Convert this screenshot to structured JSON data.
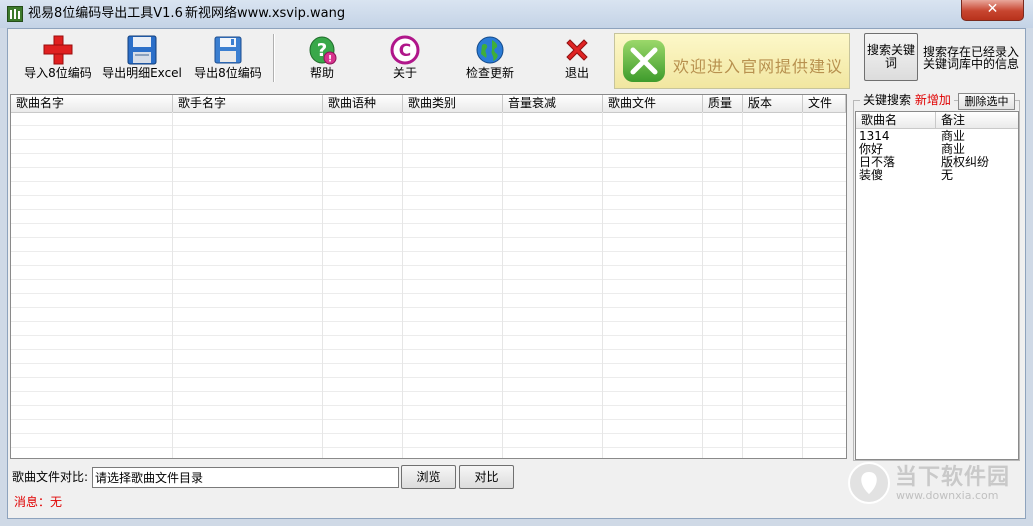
{
  "window": {
    "title": "视易8位编码导出工具V1.6",
    "subtitle": "新视网络www.xsvip.wang",
    "close_symbol": "✕"
  },
  "toolbar": {
    "items": [
      {
        "label": "导入8位编码",
        "icon": "red-plus-icon"
      },
      {
        "label": "导出明细Excel",
        "icon": "floppy-blue-icon"
      },
      {
        "label": "导出8位编码",
        "icon": "floppy-icon"
      },
      {
        "label": "帮助",
        "icon": "help-icon"
      },
      {
        "label": "关于",
        "icon": "copyright-icon"
      },
      {
        "label": "检查更新",
        "icon": "globe-icon"
      },
      {
        "label": "退出",
        "icon": "red-x-icon"
      }
    ],
    "banner_text": "欢迎进入官网提供建议"
  },
  "search": {
    "button_label_1": "搜索关键",
    "button_label_2": "词",
    "desc_1": "搜索存在已经录入",
    "desc_2": "关键词库中的信息"
  },
  "song_table": {
    "columns": [
      "歌曲名字",
      "歌手名字",
      "歌曲语种",
      "歌曲类别",
      "音量衰减",
      "歌曲文件",
      "质量",
      "版本",
      "文件"
    ],
    "rows": []
  },
  "keyword_panel": {
    "caption": "关键搜索",
    "new_label": "新增加",
    "delete_label": "删除选中",
    "columns": [
      "歌曲名",
      "备注"
    ],
    "rows": [
      {
        "name": "1314",
        "note": "商业"
      },
      {
        "name": "你好",
        "note": "商业"
      },
      {
        "name": "日不落",
        "note": "版权纠纷"
      },
      {
        "name": "装傻",
        "note": "无"
      }
    ]
  },
  "compare": {
    "label": "歌曲文件对比:",
    "dir_value": "请选择歌曲文件目录",
    "browse_label": "浏览",
    "compare_label": "对比"
  },
  "status": {
    "message": "消息：无"
  },
  "watermark": {
    "name": "当下软件园",
    "url": "www.downxia.com"
  },
  "colors": {
    "status_red": "#e00000",
    "banner_text": "#b8914f"
  }
}
